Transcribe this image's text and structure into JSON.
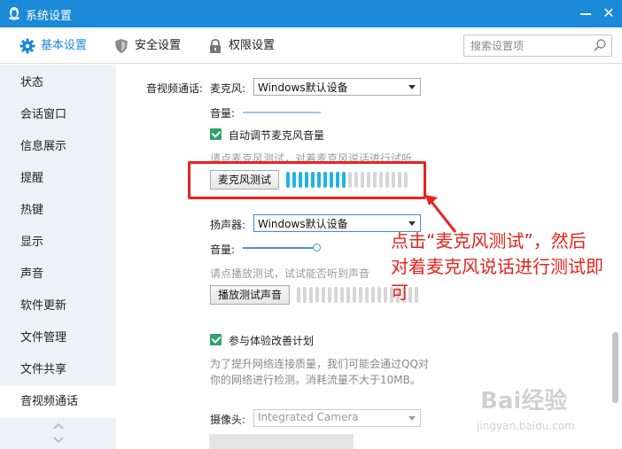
{
  "window": {
    "title": "系统设置",
    "close_glyph": "✕"
  },
  "tabs": [
    {
      "label": "基本设置",
      "icon": "gear-icon",
      "active": true
    },
    {
      "label": "安全设置",
      "icon": "shield-icon",
      "active": false
    },
    {
      "label": "权限设置",
      "icon": "lock-icon",
      "active": false
    }
  ],
  "search": {
    "placeholder": "搜索设置项"
  },
  "sidebar": {
    "items": [
      {
        "label": "状态"
      },
      {
        "label": "会话窗口"
      },
      {
        "label": "信息展示"
      },
      {
        "label": "提醒"
      },
      {
        "label": "热键"
      },
      {
        "label": "显示"
      },
      {
        "label": "声音"
      },
      {
        "label": "软件更新"
      },
      {
        "label": "文件管理"
      },
      {
        "label": "文件共享"
      },
      {
        "label": "音视频通话",
        "active": true
      }
    ]
  },
  "content": {
    "section_label": "音视频通话:",
    "mic": {
      "label": "麦克风:",
      "device": "Windows默认设备",
      "volume_label": "音量:",
      "auto_adjust": "自动调节麦克风音量",
      "auto_adjust_checked": true,
      "hint": "请点麦克风测试，对着麦克风说话进行试听",
      "test_button": "麦克风测试",
      "meter_level": 0.5
    },
    "speaker": {
      "label": "扬声器:",
      "device": "Windows默认设备",
      "volume_label": "音量:",
      "volume_level": 1.0,
      "hint": "请点播放测试，试试能否听到声音",
      "test_button": "播放测试声音",
      "meter_level": 0
    },
    "improvement": {
      "label": "参与体验改善计划",
      "checked": true,
      "desc_line1": "为了提升网络连接质量，我们可能会通过QQ对",
      "desc_line2": "你的网络进行检测。消耗流量不大于10MB。"
    },
    "camera": {
      "label": "摄像头:",
      "device": "Integrated Camera"
    }
  },
  "annotation": {
    "line1": "点击“麦克风测试”，然后",
    "line2": "对着麦克风说话进行测试即",
    "line3": "可",
    "color": "#e8231c"
  },
  "watermark": {
    "text": "Bai经验",
    "sub": "jingyan.baidu.com"
  },
  "colors": {
    "titlebar": "#1a8ad8",
    "accent": "#1a8ad8",
    "check": "#2ea36c",
    "meter_on": "#21b3e6"
  }
}
